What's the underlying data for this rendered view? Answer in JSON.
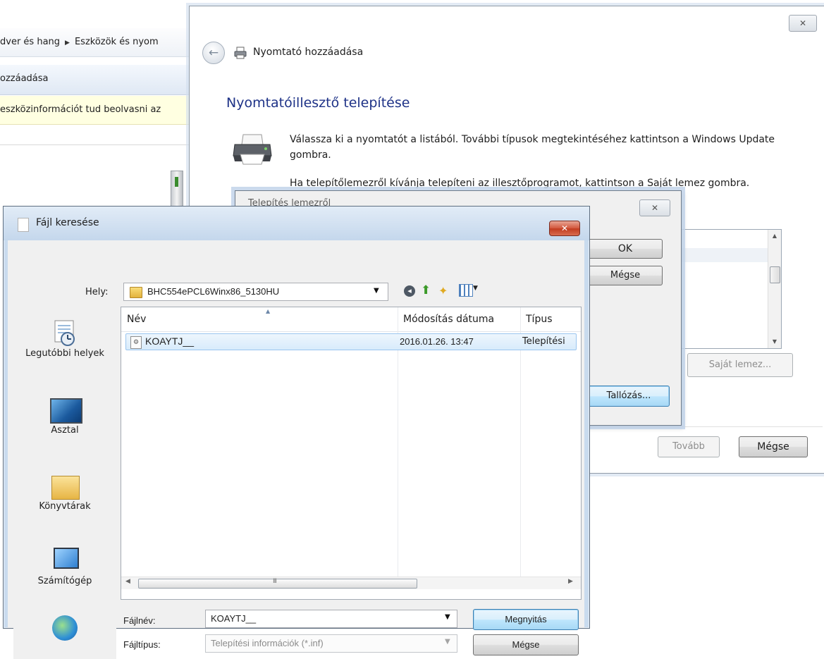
{
  "background_window": {
    "breadcrumb": [
      "dver és hang",
      "Eszközök és nyom"
    ],
    "command_bar_label": "ozzáadása",
    "info_bar_text": "eszközinformációt tud beolvasni az"
  },
  "wizard": {
    "close_glyph": "✕",
    "back_glyph": "←",
    "title": "Nyomtató hozzáadása",
    "heading": "Nyomtatóillesztő telepítése",
    "description_line1": "Válassza ki a nyomtatót a listából. További típusok megtekintéséhez kattintson a Windows Update gombra.",
    "description_line2": "Ha telepítőlemezről kívánja telepíteni az illesztőprogramot, kattintson a Saját lemez gombra.",
    "own_disk_button": "Saját lemez...",
    "next_button": "Tovább",
    "cancel_button": "Mégse"
  },
  "disk_dialog": {
    "title": "Telepítés lemezről",
    "close_glyph": "✕",
    "ok_button": "OK",
    "cancel_button": "Mégse",
    "browse_button": "Tallózás..."
  },
  "file_dialog": {
    "title": "Fájl keresése",
    "close_glyph": "✕",
    "location_label": "Hely:",
    "location_value": "BHC554ePCL6Winx86_5130HU",
    "places": {
      "recent": "Legutóbbi helyek",
      "desktop": "Asztal",
      "libraries": "Könyvtárak",
      "computer": "Számítógép"
    },
    "columns": {
      "name": "Név",
      "date": "Módosítás dátuma",
      "type": "Típus"
    },
    "files": [
      {
        "name": "KOAYTJ__",
        "date": "2016.01.26. 13:47",
        "type": "Telepítési"
      }
    ],
    "scrollbar_grip": "III",
    "filename_label": "Fájlnév:",
    "filename_value": "KOAYTJ__",
    "filetype_label": "Fájltípus:",
    "filetype_value": "Telepítési információk (*.inf)",
    "open_button": "Megnyitás",
    "cancel_button": "Mégse"
  },
  "colors": {
    "heading_blue": "#1e3287",
    "selection": "#d8ebfb",
    "close_red": "#c13b20",
    "info_bar": "#ffffe1"
  }
}
